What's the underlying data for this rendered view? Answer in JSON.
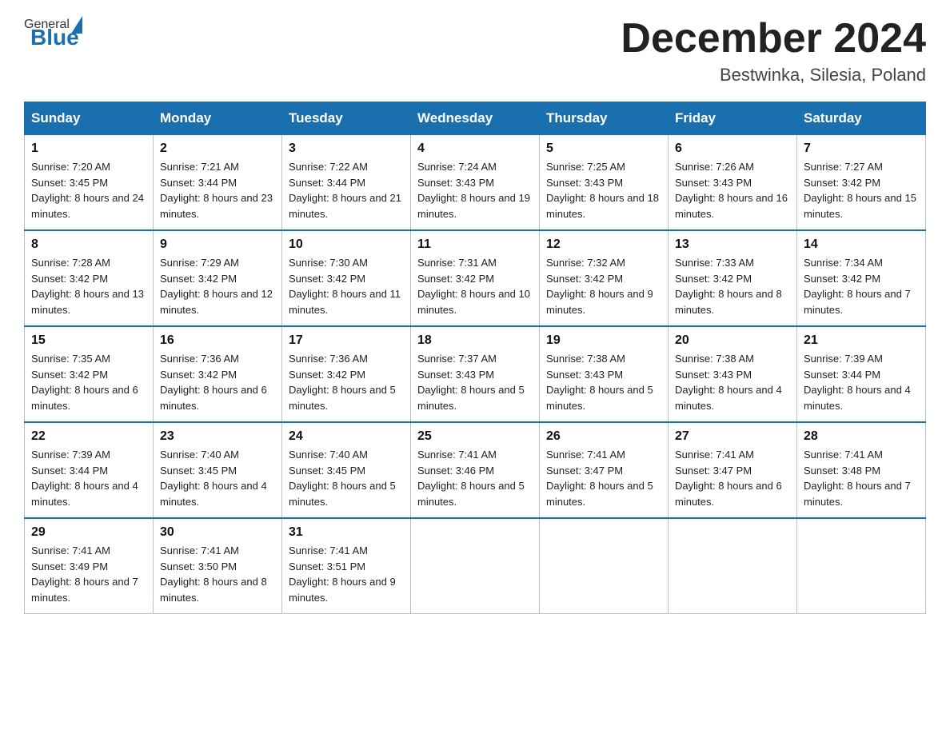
{
  "header": {
    "logo_general": "General",
    "logo_blue": "Blue",
    "title": "December 2024",
    "location": "Bestwinka, Silesia, Poland"
  },
  "calendar": {
    "days_of_week": [
      "Sunday",
      "Monday",
      "Tuesday",
      "Wednesday",
      "Thursday",
      "Friday",
      "Saturday"
    ],
    "weeks": [
      [
        {
          "day": "1",
          "sunrise": "7:20 AM",
          "sunset": "3:45 PM",
          "daylight": "8 hours and 24 minutes."
        },
        {
          "day": "2",
          "sunrise": "7:21 AM",
          "sunset": "3:44 PM",
          "daylight": "8 hours and 23 minutes."
        },
        {
          "day": "3",
          "sunrise": "7:22 AM",
          "sunset": "3:44 PM",
          "daylight": "8 hours and 21 minutes."
        },
        {
          "day": "4",
          "sunrise": "7:24 AM",
          "sunset": "3:43 PM",
          "daylight": "8 hours and 19 minutes."
        },
        {
          "day": "5",
          "sunrise": "7:25 AM",
          "sunset": "3:43 PM",
          "daylight": "8 hours and 18 minutes."
        },
        {
          "day": "6",
          "sunrise": "7:26 AM",
          "sunset": "3:43 PM",
          "daylight": "8 hours and 16 minutes."
        },
        {
          "day": "7",
          "sunrise": "7:27 AM",
          "sunset": "3:42 PM",
          "daylight": "8 hours and 15 minutes."
        }
      ],
      [
        {
          "day": "8",
          "sunrise": "7:28 AM",
          "sunset": "3:42 PM",
          "daylight": "8 hours and 13 minutes."
        },
        {
          "day": "9",
          "sunrise": "7:29 AM",
          "sunset": "3:42 PM",
          "daylight": "8 hours and 12 minutes."
        },
        {
          "day": "10",
          "sunrise": "7:30 AM",
          "sunset": "3:42 PM",
          "daylight": "8 hours and 11 minutes."
        },
        {
          "day": "11",
          "sunrise": "7:31 AM",
          "sunset": "3:42 PM",
          "daylight": "8 hours and 10 minutes."
        },
        {
          "day": "12",
          "sunrise": "7:32 AM",
          "sunset": "3:42 PM",
          "daylight": "8 hours and 9 minutes."
        },
        {
          "day": "13",
          "sunrise": "7:33 AM",
          "sunset": "3:42 PM",
          "daylight": "8 hours and 8 minutes."
        },
        {
          "day": "14",
          "sunrise": "7:34 AM",
          "sunset": "3:42 PM",
          "daylight": "8 hours and 7 minutes."
        }
      ],
      [
        {
          "day": "15",
          "sunrise": "7:35 AM",
          "sunset": "3:42 PM",
          "daylight": "8 hours and 6 minutes."
        },
        {
          "day": "16",
          "sunrise": "7:36 AM",
          "sunset": "3:42 PM",
          "daylight": "8 hours and 6 minutes."
        },
        {
          "day": "17",
          "sunrise": "7:36 AM",
          "sunset": "3:42 PM",
          "daylight": "8 hours and 5 minutes."
        },
        {
          "day": "18",
          "sunrise": "7:37 AM",
          "sunset": "3:43 PM",
          "daylight": "8 hours and 5 minutes."
        },
        {
          "day": "19",
          "sunrise": "7:38 AM",
          "sunset": "3:43 PM",
          "daylight": "8 hours and 5 minutes."
        },
        {
          "day": "20",
          "sunrise": "7:38 AM",
          "sunset": "3:43 PM",
          "daylight": "8 hours and 4 minutes."
        },
        {
          "day": "21",
          "sunrise": "7:39 AM",
          "sunset": "3:44 PM",
          "daylight": "8 hours and 4 minutes."
        }
      ],
      [
        {
          "day": "22",
          "sunrise": "7:39 AM",
          "sunset": "3:44 PM",
          "daylight": "8 hours and 4 minutes."
        },
        {
          "day": "23",
          "sunrise": "7:40 AM",
          "sunset": "3:45 PM",
          "daylight": "8 hours and 4 minutes."
        },
        {
          "day": "24",
          "sunrise": "7:40 AM",
          "sunset": "3:45 PM",
          "daylight": "8 hours and 5 minutes."
        },
        {
          "day": "25",
          "sunrise": "7:41 AM",
          "sunset": "3:46 PM",
          "daylight": "8 hours and 5 minutes."
        },
        {
          "day": "26",
          "sunrise": "7:41 AM",
          "sunset": "3:47 PM",
          "daylight": "8 hours and 5 minutes."
        },
        {
          "day": "27",
          "sunrise": "7:41 AM",
          "sunset": "3:47 PM",
          "daylight": "8 hours and 6 minutes."
        },
        {
          "day": "28",
          "sunrise": "7:41 AM",
          "sunset": "3:48 PM",
          "daylight": "8 hours and 7 minutes."
        }
      ],
      [
        {
          "day": "29",
          "sunrise": "7:41 AM",
          "sunset": "3:49 PM",
          "daylight": "8 hours and 7 minutes."
        },
        {
          "day": "30",
          "sunrise": "7:41 AM",
          "sunset": "3:50 PM",
          "daylight": "8 hours and 8 minutes."
        },
        {
          "day": "31",
          "sunrise": "7:41 AM",
          "sunset": "3:51 PM",
          "daylight": "8 hours and 9 minutes."
        },
        null,
        null,
        null,
        null
      ]
    ]
  }
}
